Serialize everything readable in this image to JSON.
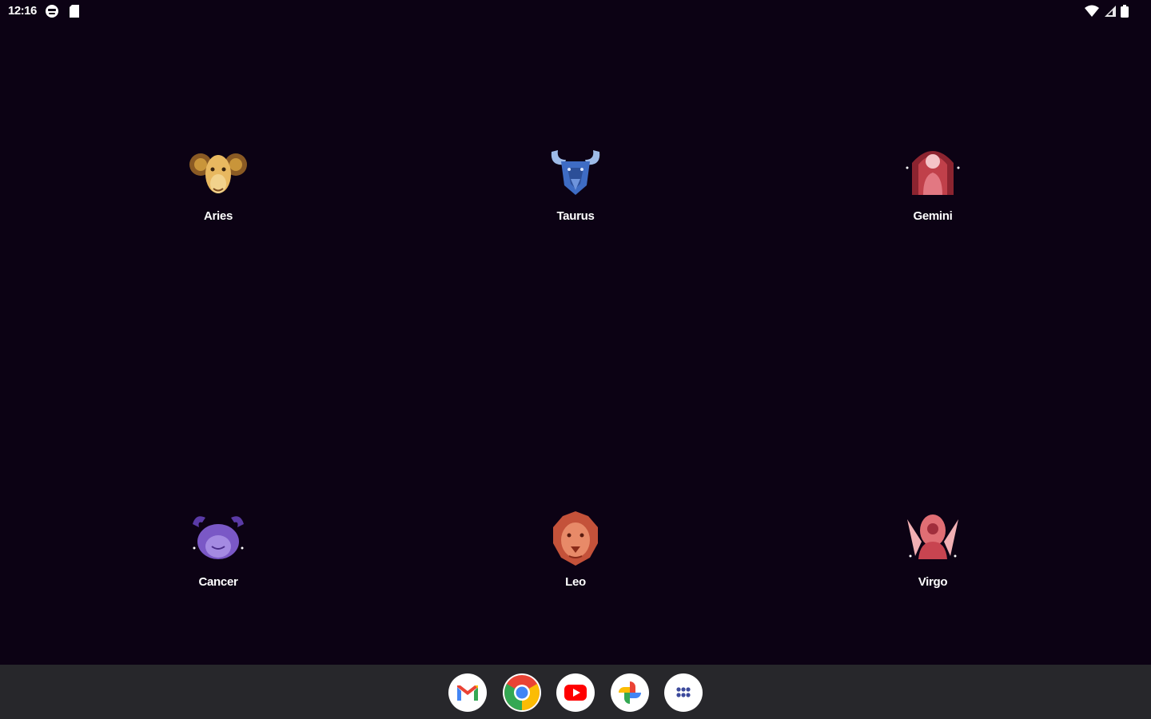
{
  "status_bar": {
    "time": "12:16",
    "left_icons": [
      "face-notification-icon",
      "sd-card-icon"
    ],
    "right_icons": [
      "wifi-icon",
      "cell-signal-icon",
      "battery-icon"
    ]
  },
  "apps": [
    {
      "label": "Aries",
      "icon": "aries-ram-icon"
    },
    {
      "label": "Taurus",
      "icon": "taurus-bull-icon"
    },
    {
      "label": "Gemini",
      "icon": "gemini-twins-icon"
    },
    {
      "label": "Cancer",
      "icon": "cancer-crab-icon"
    },
    {
      "label": "Leo",
      "icon": "leo-lion-icon"
    },
    {
      "label": "Virgo",
      "icon": "virgo-maiden-icon"
    }
  ],
  "dock": {
    "items": [
      {
        "icon": "gmail-icon"
      },
      {
        "icon": "chrome-icon"
      },
      {
        "icon": "youtube-icon"
      },
      {
        "icon": "google-photos-icon"
      },
      {
        "icon": "app-drawer-icon"
      }
    ]
  },
  "colors": {
    "background": "#0c0214",
    "dock": "#27272b",
    "aries": "#c9953a",
    "taurus": "#3e6cc4",
    "gemini": "#c0404a",
    "cancer": "#7a58c6",
    "leo": "#d86a4a",
    "virgo": "#e06e74"
  }
}
